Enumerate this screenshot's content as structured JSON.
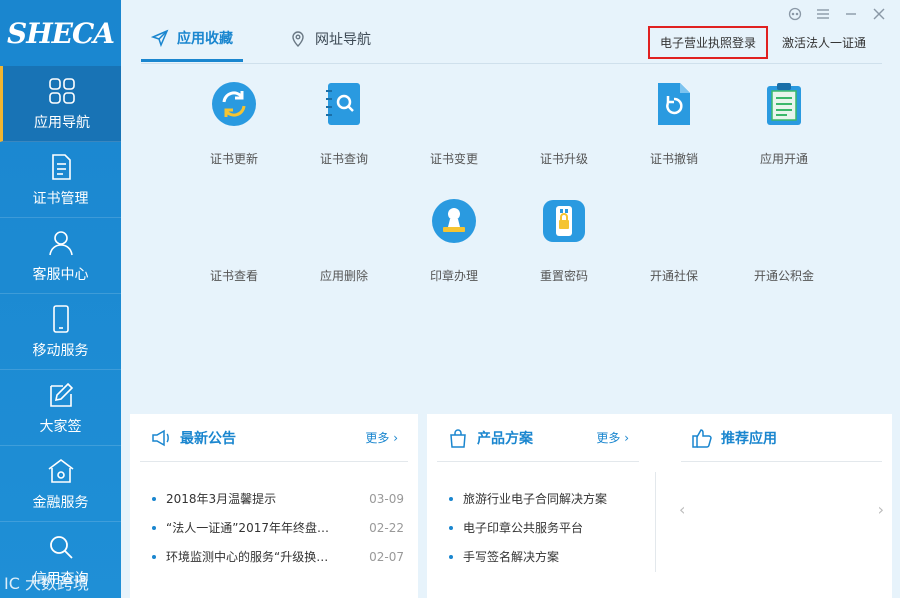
{
  "logo": {
    "text": "SHECA"
  },
  "watermark": "IC 大数跨境",
  "sidebar": {
    "items": [
      {
        "label": "应用导航",
        "icon": "grid-icon"
      },
      {
        "label": "证书管理",
        "icon": "document-icon"
      },
      {
        "label": "客服中心",
        "icon": "user-icon"
      },
      {
        "label": "移动服务",
        "icon": "mobile-icon"
      },
      {
        "label": "大家签",
        "icon": "pen-icon"
      },
      {
        "label": "金融服务",
        "icon": "bank-icon"
      },
      {
        "label": "信用查询",
        "icon": "search-icon"
      }
    ]
  },
  "tabs": [
    {
      "label": "应用收藏",
      "icon": "paper-plane-icon"
    },
    {
      "label": "网址导航",
      "icon": "location-pin-icon"
    }
  ],
  "toplinks": {
    "license_login": "电子营业执照登录",
    "activate": "激活法人一证通"
  },
  "apps": [
    {
      "label": "证书更新",
      "icon": "refresh-icon"
    },
    {
      "label": "证书查询",
      "icon": "book-search-icon"
    },
    {
      "label": "证书变更",
      "icon": ""
    },
    {
      "label": "证书升级",
      "icon": ""
    },
    {
      "label": "证书撤销",
      "icon": "file-undo-icon"
    },
    {
      "label": "应用开通",
      "icon": "clipboard-icon"
    },
    {
      "label": "证书查看",
      "icon": ""
    },
    {
      "label": "应用删除",
      "icon": ""
    },
    {
      "label": "印章办理",
      "icon": "stamp-icon"
    },
    {
      "label": "重置密码",
      "icon": "usb-key-icon"
    },
    {
      "label": "开通社保",
      "icon": ""
    },
    {
      "label": "开通公积金",
      "icon": ""
    }
  ],
  "announcements": {
    "title": "最新公告",
    "more": "更多",
    "items": [
      {
        "text": "2018年3月温馨提示",
        "date": "03-09"
      },
      {
        "text": "“法人一证通”2017年年终盘…",
        "date": "02-22"
      },
      {
        "text": "环境监测中心的服务“升级换…",
        "date": "02-07"
      }
    ]
  },
  "products": {
    "title": "产品方案",
    "more": "更多",
    "items": [
      {
        "text": "旅游行业电子合同解决方案"
      },
      {
        "text": "电子印章公共服务平台"
      },
      {
        "text": "手写签名解决方案"
      }
    ]
  },
  "recommend": {
    "title": "推荐应用"
  },
  "colors": {
    "primary": "#1a86cf",
    "sidebar_active": "#1873b5",
    "highlight_border": "#e02020"
  }
}
